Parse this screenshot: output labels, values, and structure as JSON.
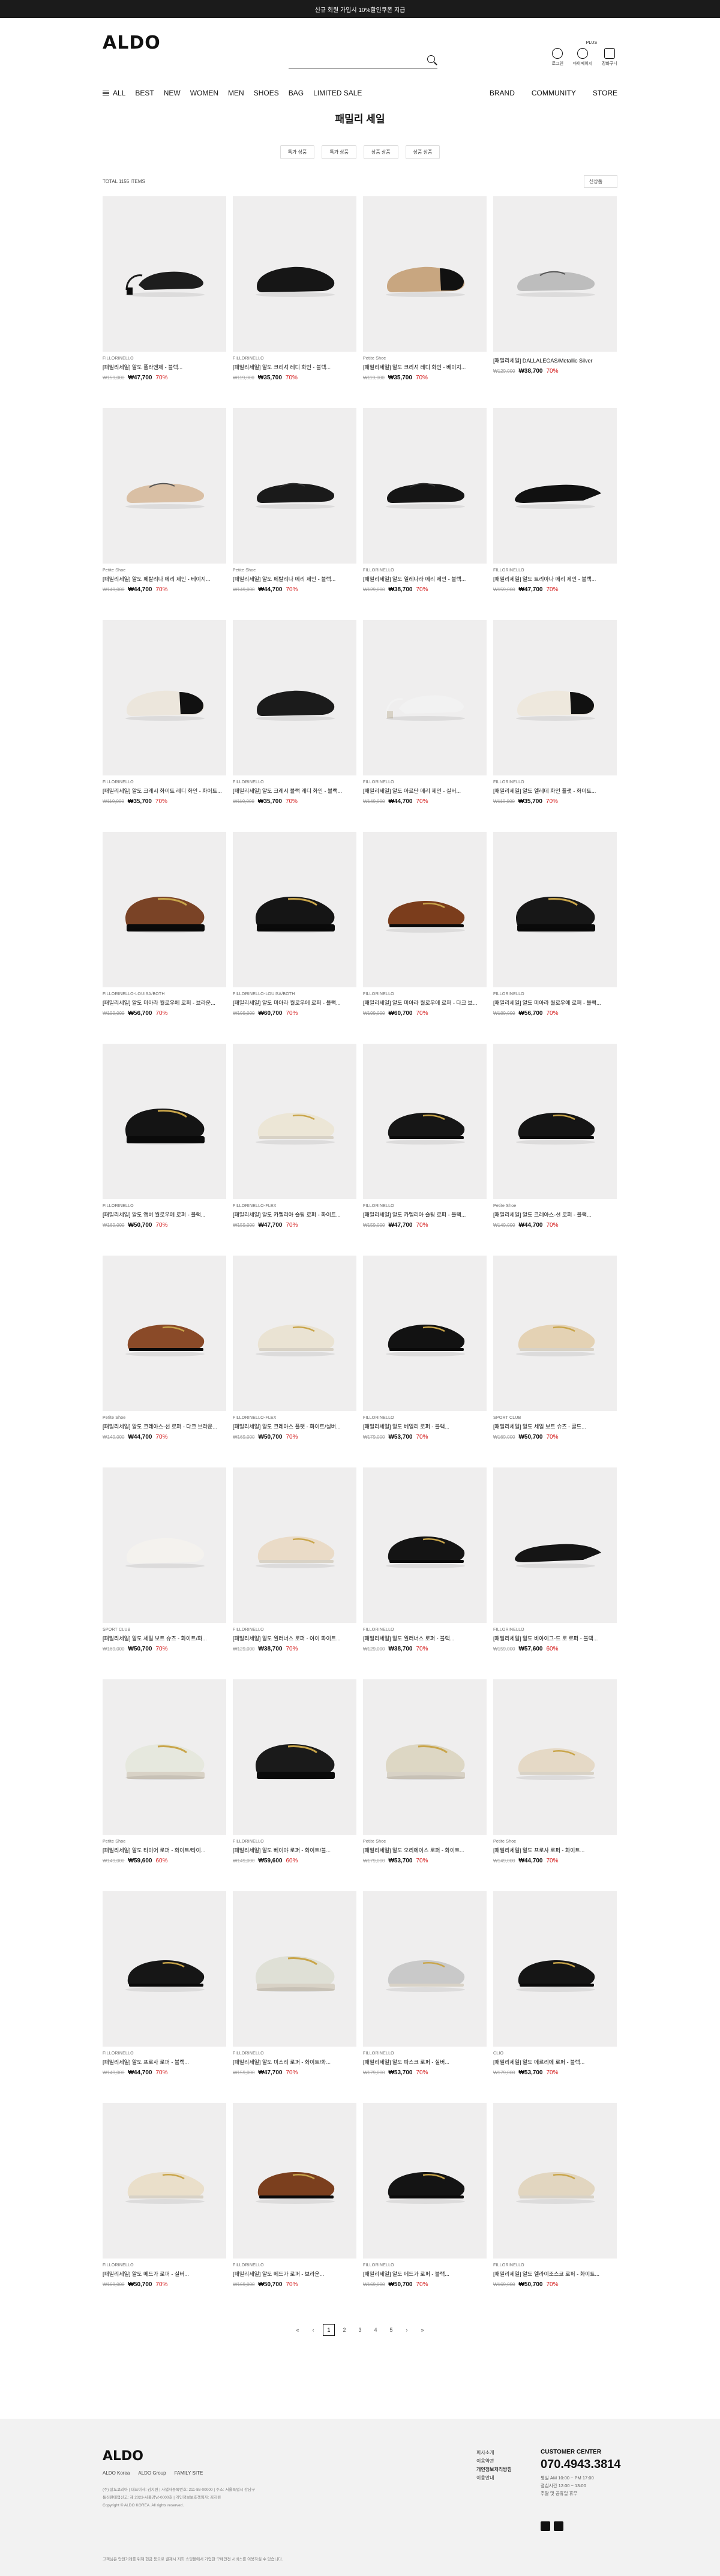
{
  "topbar": {
    "text": "신규 회원 가입시 10%할인쿠폰 지급"
  },
  "header": {
    "logo": "ALDO",
    "search_placeholder": "",
    "user_menu": [
      {
        "label": "로그인",
        "icon": "user-icon"
      },
      {
        "label": "마이페이지",
        "icon": "profile-icon"
      },
      {
        "label": "장바구니",
        "icon": "cart-icon"
      }
    ],
    "login_tag": "PLUS"
  },
  "nav": {
    "left": [
      "ALL",
      "BEST",
      "NEW",
      "WOMEN",
      "MEN",
      "SHOES",
      "BAG",
      "LIMITED SALE"
    ],
    "right": [
      "BRAND",
      "COMMUNITY",
      "STORE"
    ]
  },
  "page": {
    "title": "패밀리 세일"
  },
  "sorts": [
    "특가 상품",
    "특가 상품",
    "상품 상품",
    "상품 상품"
  ],
  "toolbar": {
    "total": "TOTAL 1155 ITEMS",
    "sort_select": "신상품"
  },
  "products": [
    {
      "brand": "FILLORINELLO",
      "name": "[패밀리세일] 알도 플라엔제 - 블랙...",
      "orig": "₩159,000",
      "sale": "₩47,700",
      "pct": "70%",
      "color": "#1d1d1d",
      "kind": "slingback"
    },
    {
      "brand": "FILLORINELLO",
      "name": "[패밀리세일] 알도 크리셔 레디 화인 - 블랙...",
      "orig": "₩119,000",
      "sale": "₩35,700",
      "pct": "70%",
      "color": "#161616",
      "kind": "flat"
    },
    {
      "brand": "Petite Shoe",
      "name": "[패밀리세일] 알도 크리셔 레디 화인 - 베이지...",
      "orig": "₩119,000",
      "sale": "₩35,700",
      "pct": "70%",
      "color": "#c8a680",
      "kind": "flat-toe"
    },
    {
      "brand": "",
      "name": "[패밀리세일] DALLALEGAS/Metallic Silver",
      "orig": "₩129,000",
      "sale": "₩38,700",
      "pct": "70%",
      "color": "#bdbdbd",
      "kind": "mary"
    },
    {
      "brand": "Petite Shoe",
      "name": "[패밀리세일] 알도 페탈리나 메리 제인 - 베이지...",
      "orig": "₩149,000",
      "sale": "₩44,700",
      "pct": "70%",
      "color": "#d9bfa4",
      "kind": "mary"
    },
    {
      "brand": "Petite Shoe",
      "name": "[패밀리세일] 알도 페탈리나 메리 제인 - 블랙...",
      "orig": "₩149,000",
      "sale": "₩44,700",
      "pct": "70%",
      "color": "#1a1a1a",
      "kind": "mary"
    },
    {
      "brand": "FILLORINELLO",
      "name": "[패밀리세일] 알도 일레나라 메리 제인 - 블랙...",
      "orig": "₩129,000",
      "sale": "₩38,700",
      "pct": "70%",
      "color": "#151515",
      "kind": "mary"
    },
    {
      "brand": "FILLORINELLO",
      "name": "[패밀리세일] 알도 트리아나 메리 제인 - 블랙...",
      "orig": "₩159,000",
      "sale": "₩47,700",
      "pct": "70%",
      "color": "#111",
      "kind": "pointy"
    },
    {
      "brand": "FILLORINELLO",
      "name": "[패밀리세일] 알도 크레시 화이트 레디 화인 - 화이트...",
      "orig": "₩119,000",
      "sale": "₩35,700",
      "pct": "70%",
      "color": "#ece6dc",
      "kind": "flat-toe"
    },
    {
      "brand": "FILLORINELLO",
      "name": "[패밀리세일] 알도 크레시 블랙 레디 화인 - 블랙...",
      "orig": "₩119,000",
      "sale": "₩35,700",
      "pct": "70%",
      "color": "#1b1b1b",
      "kind": "flat"
    },
    {
      "brand": "FILLORINELLO",
      "name": "[패밀리세일] 알도 아르단 메리 제인 - 실버...",
      "orig": "₩149,000",
      "sale": "₩44,700",
      "pct": "70%",
      "color": "#f2f2f2",
      "kind": "slingback"
    },
    {
      "brand": "FILLORINELLO",
      "name": "[패밀리세일] 알도 엘레데 화인 플랫 - 화이트...",
      "orig": "₩119,000",
      "sale": "₩35,700",
      "pct": "70%",
      "color": "#eee8dd",
      "kind": "flat-toe"
    },
    {
      "brand": "FILLORINELLO-LOUISA/BOTH",
      "name": "[패밀리세일] 알도 미아라 월로우에 로퍼 - 브라운...",
      "orig": "₩199,000",
      "sale": "₩56,700",
      "pct": "70%",
      "color": "#7a4326",
      "kind": "lug"
    },
    {
      "brand": "FILLORINELLO-LOUISA/BOTH",
      "name": "[패밀리세일] 알도 미아라 월로우에 로퍼 - 블랙...",
      "orig": "₩199,000",
      "sale": "₩60,700",
      "pct": "70%",
      "color": "#151515",
      "kind": "lug"
    },
    {
      "brand": "FILLORINELLO",
      "name": "[패밀리세일] 알도 미아라 월로우에 로퍼 - 다크 브...",
      "orig": "₩199,000",
      "sale": "₩60,700",
      "pct": "70%",
      "color": "#7b3d1c",
      "kind": "loafer"
    },
    {
      "brand": "FILLORINELLO",
      "name": "[패밀리세일] 알도 미아라 월로우에 로퍼 - 블랙...",
      "orig": "₩189,000",
      "sale": "₩56,700",
      "pct": "70%",
      "color": "#171717",
      "kind": "lug"
    },
    {
      "brand": "FILLORINELLO",
      "name": "[패밀리세일] 알도 앰버 월로우에 로퍼 - 블랙...",
      "orig": "₩169,000",
      "sale": "₩50,700",
      "pct": "70%",
      "color": "#141414",
      "kind": "lug"
    },
    {
      "brand": "FILLORINELLO-FLEX",
      "name": "[패밀리세일] 알도 카멜리아 숄팅 로퍼 - 화이트...",
      "orig": "₩159,000",
      "sale": "₩47,700",
      "pct": "70%",
      "color": "#ece6d6",
      "kind": "loafer"
    },
    {
      "brand": "FILLORINELLO",
      "name": "[패밀리세일] 알도 카멜리아 숄팅 로퍼 - 블랙...",
      "orig": "₩159,000",
      "sale": "₩47,700",
      "pct": "70%",
      "color": "#161616",
      "kind": "loafer"
    },
    {
      "brand": "Petite Shoe",
      "name": "[패밀리세일] 알도 크레아스-선 로퍼 - 블랙...",
      "orig": "₩149,000",
      "sale": "₩44,700",
      "pct": "70%",
      "color": "#151515",
      "kind": "loafer"
    },
    {
      "brand": "Petite Shoe",
      "name": "[패밀리세일] 알도 크레아스-선 로퍼 - 다크 브라운...",
      "orig": "₩149,000",
      "sale": "₩44,700",
      "pct": "70%",
      "color": "#8a4a28",
      "kind": "loafer"
    },
    {
      "brand": "FILLORINELLO-FLEX",
      "name": "[패밀리세일] 알도 크레아스 플랫 - 화이트/실버...",
      "orig": "₩169,000",
      "sale": "₩50,700",
      "pct": "70%",
      "color": "#eae3d3",
      "kind": "loafer"
    },
    {
      "brand": "FILLORINELLO",
      "name": "[패밀리세일] 알도 베일리 로퍼 - 블랙...",
      "orig": "₩179,000",
      "sale": "₩53,700",
      "pct": "70%",
      "color": "#121212",
      "kind": "loafer"
    },
    {
      "brand": "SPORT CLUB",
      "name": "[패밀리세일] 알도 세일 보트 슈즈 - 골드...",
      "orig": "₩169,000",
      "sale": "₩50,700",
      "pct": "70%",
      "color": "#e4d2b4",
      "kind": "loafer"
    },
    {
      "brand": "SPORT CLUB",
      "name": "[패밀리세일] 알도 세일 보트 슈즈 - 화이트/화...",
      "orig": "₩169,000",
      "sale": "₩50,700",
      "pct": "70%",
      "color": "#f4f2ee",
      "kind": "flat"
    },
    {
      "brand": "FILLORINELLO",
      "name": "[패밀리세일] 알도 월러너스 로퍼 - 아이 화이트...",
      "orig": "₩129,000",
      "sale": "₩38,700",
      "pct": "70%",
      "color": "#eadbc7",
      "kind": "loafer"
    },
    {
      "brand": "FILLORINELLO",
      "name": "[패밀리세일] 알도 월러너스 로퍼 - 블랙...",
      "orig": "₩129,000",
      "sale": "₩38,700",
      "pct": "70%",
      "color": "#141414",
      "kind": "loafer"
    },
    {
      "brand": "FILLORINELLO",
      "name": "[패밀리세일] 알도 비아이그-드 로 로퍼 - 블랙...",
      "orig": "₩159,000",
      "sale": "₩57,600",
      "pct": "60%",
      "color": "#151515",
      "kind": "pointy"
    },
    {
      "brand": "Petite Shoe",
      "name": "[패밀리세일] 알도 타이어 로퍼 - 화이트/타이...",
      "orig": "₩149,000",
      "sale": "₩59,600",
      "pct": "60%",
      "color": "#e6e8de",
      "kind": "lug"
    },
    {
      "brand": "FILLORINELLO",
      "name": "[패밀리세일] 알도 베이야 로퍼 - 화이트/블...",
      "orig": "₩149,000",
      "sale": "₩59,600",
      "pct": "60%",
      "color": "#1a1a1a",
      "kind": "lug"
    },
    {
      "brand": "Petite Shoe",
      "name": "[패밀리세일] 알도 오리에이스 로퍼 - 화이트...",
      "orig": "₩179,000",
      "sale": "₩53,700",
      "pct": "70%",
      "color": "#ddd7c4",
      "kind": "lug"
    },
    {
      "brand": "Petite Shoe",
      "name": "[패밀리세일] 알도 프로사 로퍼 - 화이트...",
      "orig": "₩149,000",
      "sale": "₩44,700",
      "pct": "70%",
      "color": "#e5d9c6",
      "kind": "loafer"
    },
    {
      "brand": "FILLORINELLO",
      "name": "[패밀리세일] 알도 프로사 로퍼 - 블랙...",
      "orig": "₩149,000",
      "sale": "₩44,700",
      "pct": "70%",
      "color": "#161616",
      "kind": "loafer"
    },
    {
      "brand": "FILLORINELLO",
      "name": "[패밀리세일] 알도 미스리 로퍼 - 화이트/화...",
      "orig": "₩159,000",
      "sale": "₩47,700",
      "pct": "70%",
      "color": "#dfe0d6",
      "kind": "lug"
    },
    {
      "brand": "FILLORINELLO",
      "name": "[패밀리세일] 알도 파스크 로퍼 - 실버...",
      "orig": "₩179,000",
      "sale": "₩53,700",
      "pct": "70%",
      "color": "#c9c9c9",
      "kind": "loafer"
    },
    {
      "brand": "CLIO",
      "name": "[패밀리세일] 알도 메르리에 로퍼 - 블랙...",
      "orig": "₩179,000",
      "sale": "₩53,700",
      "pct": "70%",
      "color": "#151515",
      "kind": "loafer"
    },
    {
      "brand": "FILLORINELLO",
      "name": "[패밀리세일] 알도 메드가 로퍼 - 실버...",
      "orig": "₩169,000",
      "sale": "₩50,700",
      "pct": "70%",
      "color": "#eadfca",
      "kind": "loafer"
    },
    {
      "brand": "FILLORINELLO",
      "name": "[패밀리세일] 알도 메드가 로퍼 - 브라운...",
      "orig": "₩169,000",
      "sale": "₩50,700",
      "pct": "70%",
      "color": "#7b3f1e",
      "kind": "loafer"
    },
    {
      "brand": "FILLORINELLO",
      "name": "[패밀리세일] 알도 메드가 로퍼 - 블랙...",
      "orig": "₩169,000",
      "sale": "₩50,700",
      "pct": "70%",
      "color": "#141414",
      "kind": "loafer"
    },
    {
      "brand": "FILLORINELLO",
      "name": "[패밀리세일] 알도 엘라이조스코 로퍼 - 화이트...",
      "orig": "₩169,000",
      "sale": "₩50,700",
      "pct": "70%",
      "color": "#e2d6c0",
      "kind": "loafer"
    }
  ],
  "pager": [
    "«",
    "‹",
    "1",
    "2",
    "3",
    "4",
    "5",
    "›",
    "»"
  ],
  "pager_current": "1",
  "footer": {
    "logo": "ALDO",
    "links": [
      "ALDO Korea",
      "ALDO Group",
      "FAMILY SITE"
    ],
    "info": [
      "(주) 알도코리아 | 대표이사: 김지원 | 사업자등록번호: 211-88-00000 | 주소: 서울특별시 강남구",
      "통신판매업신고: 제 2023-서울강남-0000호 | 개인정보보호책임자: 김지원",
      "Copyright © ALDO KOREA. All rights reserved."
    ],
    "menu": [
      "회사소개",
      "이용약관",
      "개인정보처리방침",
      "이용안내"
    ],
    "cs": {
      "title": "CUSTOMER CENTER",
      "phone": "070.4943.3814",
      "hours": [
        "평일 AM 10:00 ~ PM 17:00",
        "점심시간 12:00 ~ 13:00",
        "주말 및 공휴일 휴무"
      ]
    },
    "note": "고객님은 안전거래를 위해 현금 등으로 결제시 저희 쇼핑몰에서 가입한 구매안전 서비스를 이용하실 수 있습니다."
  }
}
